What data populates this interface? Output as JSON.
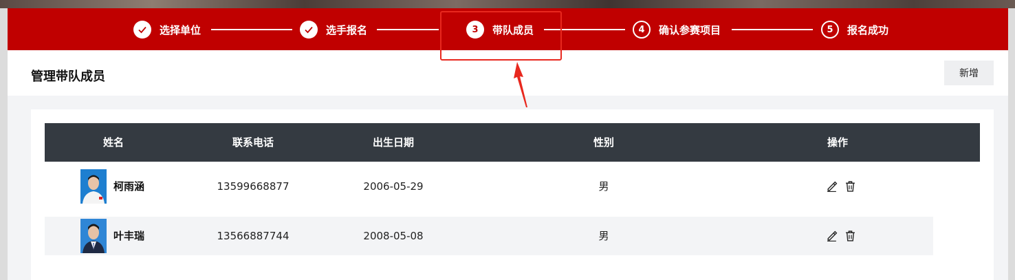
{
  "steps": [
    {
      "number": "",
      "label": "选择单位",
      "status": "done"
    },
    {
      "number": "",
      "label": "选手报名",
      "status": "done"
    },
    {
      "number": "3",
      "label": "带队成员",
      "status": "active"
    },
    {
      "number": "4",
      "label": "确认参赛项目",
      "status": "todo"
    },
    {
      "number": "5",
      "label": "报名成功",
      "status": "todo"
    }
  ],
  "header": {
    "title": "管理带队成员",
    "add_label": "新增"
  },
  "table": {
    "columns": [
      "姓名",
      "联系电话",
      "出生日期",
      "性别",
      "操作"
    ],
    "rows": [
      {
        "name": "柯雨涵",
        "phone": "13599668877",
        "birth": "2006-05-29",
        "gender": "男",
        "actions": [
          "edit-icon",
          "delete-icon"
        ]
      },
      {
        "name": "叶丰瑞",
        "phone": "13566887744",
        "birth": "2008-05-08",
        "gender": "男",
        "actions": [
          "edit-icon",
          "delete-icon"
        ]
      }
    ]
  },
  "colors": {
    "brand": "#c00000",
    "header_bg": "#343a41",
    "highlight": "#e8281e"
  }
}
